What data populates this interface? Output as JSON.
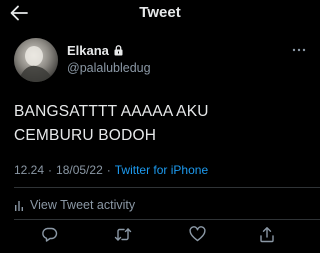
{
  "header": {
    "title": "Tweet",
    "back_icon": "arrow-left-icon"
  },
  "tweet": {
    "display_name": "Elkana",
    "handle": "@palalubledug",
    "protected_icon": "lock-icon",
    "text": "BANGSATTTT AAAAA AKU\nCEMBURU BODOH",
    "time": "12.24",
    "date": "18/05/22",
    "separator": "·",
    "source": "Twitter for iPhone",
    "activity_label": "View Tweet activity"
  },
  "actions": {
    "reply_icon": "reply-icon",
    "retweet_icon": "retweet-icon",
    "like_icon": "heart-icon",
    "share_icon": "share-icon"
  },
  "colors": {
    "background": "#000000",
    "text_primary": "#e7e9ea",
    "text_secondary": "#8b98a5",
    "link": "#1d9bf0",
    "divider": "#2f3336"
  }
}
